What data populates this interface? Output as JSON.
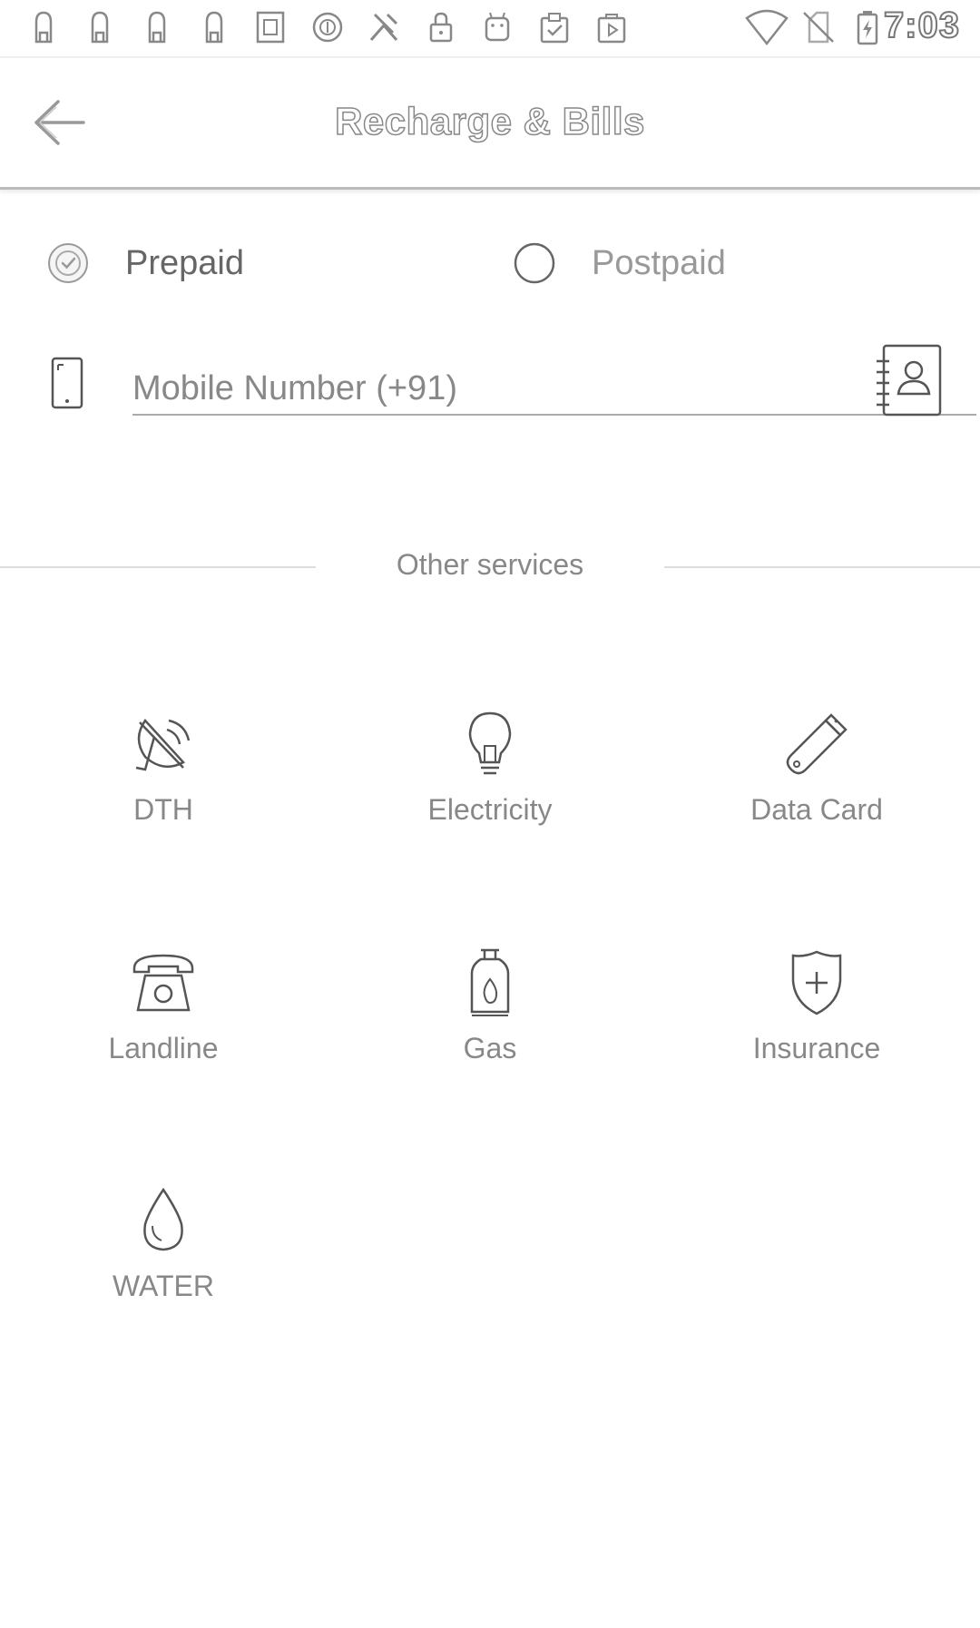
{
  "status_bar": {
    "time": "7:03",
    "icons": [
      "notification-icon",
      "notification-icon",
      "notification-icon",
      "notification-icon",
      "sim-toolkit-icon",
      "vpn-icon",
      "app-icon",
      "lock-icon",
      "android-icon",
      "clipboard-icon",
      "play-store-icon",
      "wifi-icon",
      "no-sim-icon",
      "battery-charging-icon"
    ]
  },
  "app_bar": {
    "title": "Recharge & Bills",
    "back_icon": "back-arrow-icon"
  },
  "plan_type": {
    "options": [
      {
        "label": "Prepaid",
        "selected": true
      },
      {
        "label": "Postpaid",
        "selected": false
      }
    ]
  },
  "mobile": {
    "placeholder": "Mobile Number (+91)",
    "value": ""
  },
  "other_services": {
    "heading": "Other services",
    "items": [
      {
        "label": "DTH",
        "icon": "satellite-dish-icon"
      },
      {
        "label": "Electricity",
        "icon": "light-bulb-icon"
      },
      {
        "label": "Data Card",
        "icon": "usb-dongle-icon"
      },
      {
        "label": "Landline",
        "icon": "telephone-icon"
      },
      {
        "label": "Gas",
        "icon": "gas-cylinder-icon"
      },
      {
        "label": "Insurance",
        "icon": "shield-plus-icon"
      },
      {
        "label": "WATER",
        "icon": "water-drop-icon"
      }
    ]
  },
  "colors": {
    "text": "#777777",
    "line": "#dddddd",
    "background": "#ffffff"
  }
}
